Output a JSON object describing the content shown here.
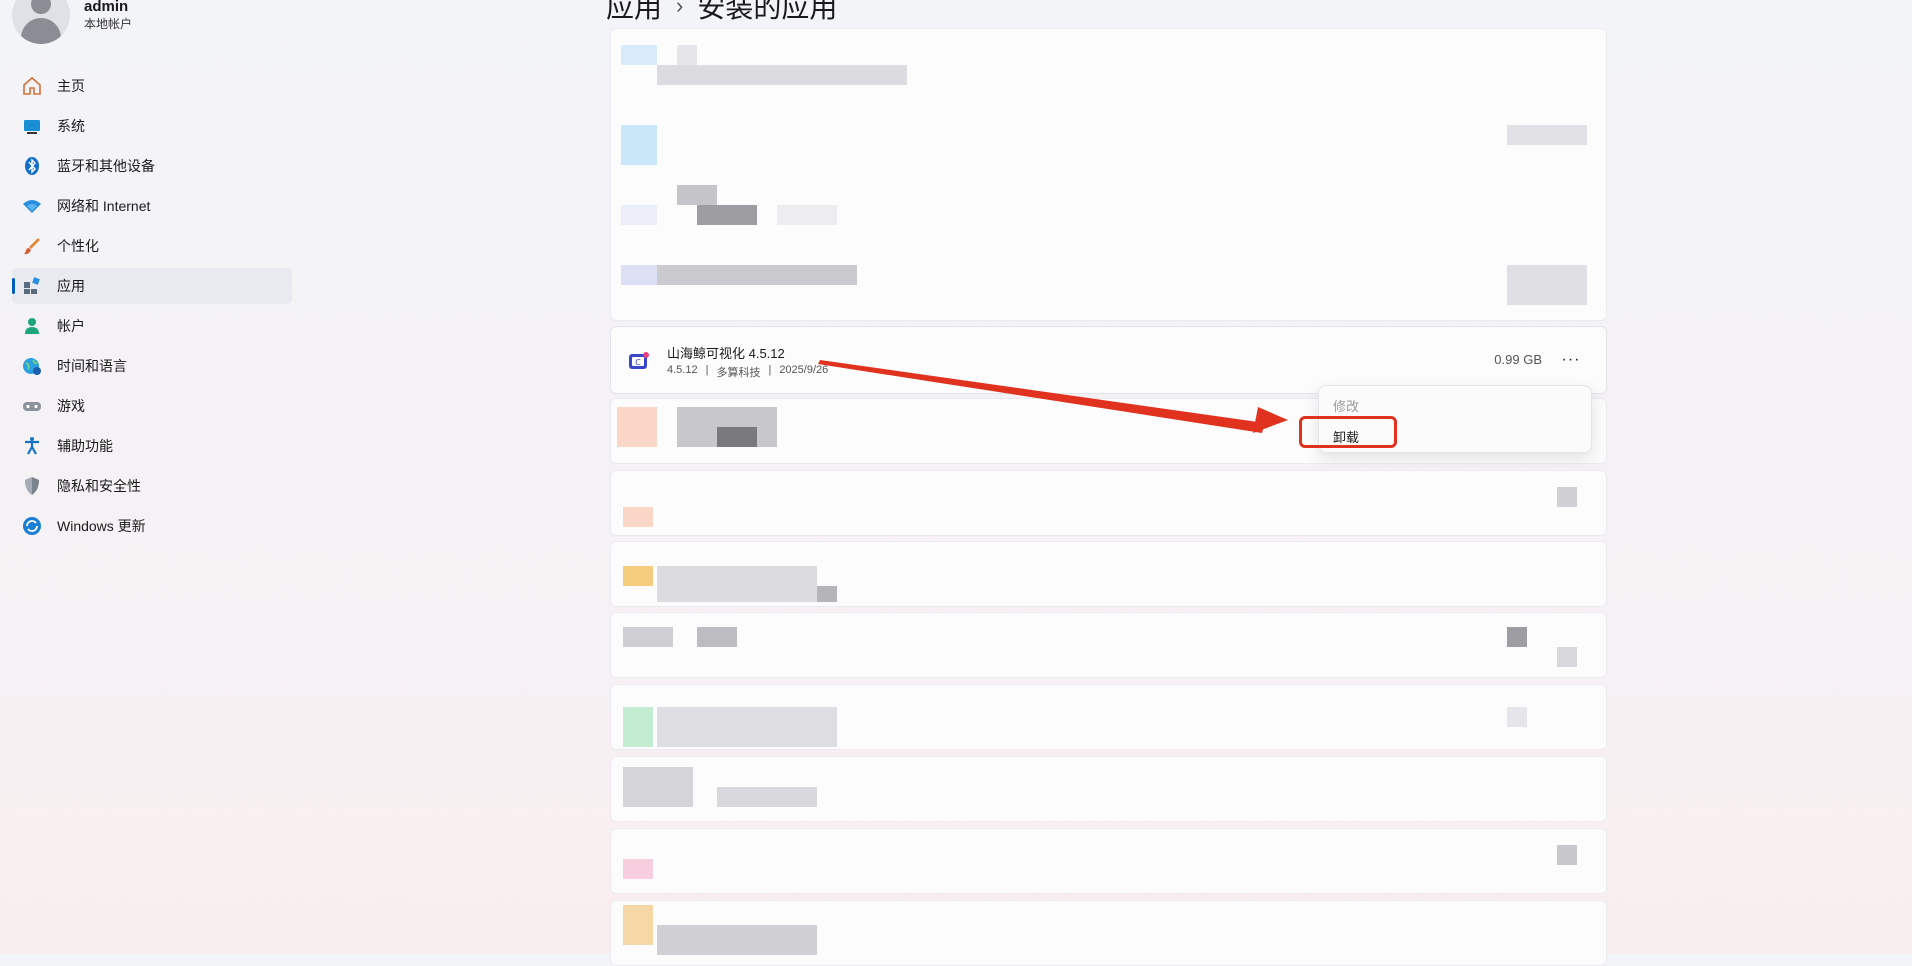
{
  "profile": {
    "name": "admin",
    "subtitle": "本地帐户"
  },
  "sidebar": {
    "items": [
      {
        "label": "主页",
        "icon": "home-icon"
      },
      {
        "label": "系统",
        "icon": "monitor-icon"
      },
      {
        "label": "蓝牙和其他设备",
        "icon": "bluetooth-icon"
      },
      {
        "label": "网络和 Internet",
        "icon": "wifi-icon"
      },
      {
        "label": "个性化",
        "icon": "brush-icon"
      },
      {
        "label": "应用",
        "icon": "apps-icon",
        "active": true
      },
      {
        "label": "帐户",
        "icon": "account-icon"
      },
      {
        "label": "时间和语言",
        "icon": "globe-clock-icon"
      },
      {
        "label": "游戏",
        "icon": "gamepad-icon"
      },
      {
        "label": "辅助功能",
        "icon": "accessibility-icon"
      },
      {
        "label": "隐私和安全性",
        "icon": "shield-icon"
      },
      {
        "label": "Windows 更新",
        "icon": "update-icon"
      }
    ]
  },
  "breadcrumb": {
    "parent": "应用",
    "separator": "›",
    "current": "安装的应用"
  },
  "app": {
    "name": "山海鲸可视化 4.5.12",
    "version": "4.5.12",
    "publisher": "多算科技",
    "date": "2025/9/26",
    "meta_sep": "|",
    "size": "0.99 GB",
    "more": "···"
  },
  "menu": {
    "modify": "修改",
    "uninstall": "卸载"
  },
  "colors": {
    "accent": "#005fb8",
    "annotation": "#e0321f"
  }
}
